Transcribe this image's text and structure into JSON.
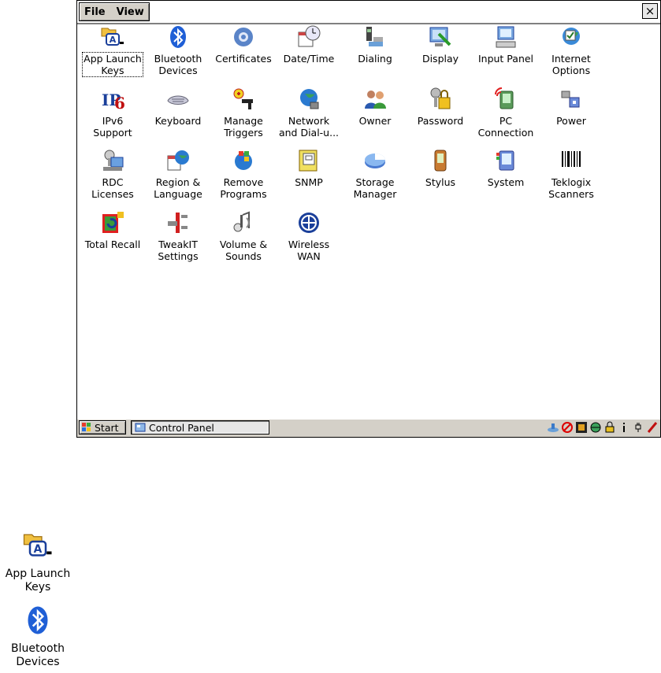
{
  "menu": {
    "file": "File",
    "view": "View"
  },
  "window": {
    "close": "×"
  },
  "icons": [
    {
      "name": "app-launch-keys",
      "icon": "app-launch-keys-icon",
      "l1": "App Launch",
      "l2": "Keys"
    },
    {
      "name": "bluetooth-devices",
      "icon": "bluetooth-icon",
      "l1": "Bluetooth",
      "l2": "Devices"
    },
    {
      "name": "certificates",
      "icon": "certificates-icon",
      "l1": "Certificates",
      "l2": ""
    },
    {
      "name": "date-time",
      "icon": "date-time-icon",
      "l1": "Date/Time",
      "l2": ""
    },
    {
      "name": "dialing",
      "icon": "dialing-icon",
      "l1": "Dialing",
      "l2": ""
    },
    {
      "name": "display",
      "icon": "display-icon",
      "l1": "Display",
      "l2": ""
    },
    {
      "name": "input-panel",
      "icon": "input-panel-icon",
      "l1": "Input Panel",
      "l2": ""
    },
    {
      "name": "internet-options",
      "icon": "internet-options-icon",
      "l1": "Internet",
      "l2": "Options"
    },
    {
      "name": "ipv6-support",
      "icon": "ipv6-icon",
      "l1": "IPv6",
      "l2": "Support"
    },
    {
      "name": "keyboard",
      "icon": "keyboard-icon",
      "l1": "Keyboard",
      "l2": ""
    },
    {
      "name": "manage-triggers",
      "icon": "manage-triggers-icon",
      "l1": "Manage",
      "l2": "Triggers"
    },
    {
      "name": "network-dialup",
      "icon": "network-icon",
      "l1": "Network",
      "l2": "and Dial-u..."
    },
    {
      "name": "owner",
      "icon": "owner-icon",
      "l1": "Owner",
      "l2": ""
    },
    {
      "name": "password",
      "icon": "password-icon",
      "l1": "Password",
      "l2": ""
    },
    {
      "name": "pc-connection",
      "icon": "pc-connection-icon",
      "l1": "PC",
      "l2": "Connection"
    },
    {
      "name": "power",
      "icon": "power-icon",
      "l1": "Power",
      "l2": ""
    },
    {
      "name": "rdc-licenses",
      "icon": "rdc-licenses-icon",
      "l1": "RDC",
      "l2": "Licenses"
    },
    {
      "name": "region-language",
      "icon": "region-language-icon",
      "l1": "Region &",
      "l2": "Language"
    },
    {
      "name": "remove-programs",
      "icon": "remove-programs-icon",
      "l1": "Remove",
      "l2": "Programs"
    },
    {
      "name": "snmp",
      "icon": "snmp-icon",
      "l1": "SNMP",
      "l2": ""
    },
    {
      "name": "storage-manager",
      "icon": "storage-manager-icon",
      "l1": "Storage",
      "l2": "Manager"
    },
    {
      "name": "stylus",
      "icon": "stylus-icon",
      "l1": "Stylus",
      "l2": ""
    },
    {
      "name": "system",
      "icon": "system-icon",
      "l1": "System",
      "l2": ""
    },
    {
      "name": "teklogix-scanners",
      "icon": "barcode-scanner-icon",
      "l1": "Teklogix",
      "l2": "Scanners"
    },
    {
      "name": "total-recall",
      "icon": "total-recall-icon",
      "l1": "Total Recall",
      "l2": ""
    },
    {
      "name": "tweakit-settings",
      "icon": "tweakit-icon",
      "l1": "TweakIT",
      "l2": "Settings"
    },
    {
      "name": "volume-sounds",
      "icon": "volume-icon",
      "l1": "Volume &",
      "l2": "Sounds"
    },
    {
      "name": "wireless-wan",
      "icon": "wireless-wan-icon",
      "l1": "Wireless",
      "l2": "WAN"
    }
  ],
  "taskbar": {
    "start": "Start",
    "task": "Control Panel"
  },
  "zoom": [
    {
      "name": "zoom-app-launch-keys",
      "icon": "app-launch-keys-icon",
      "l1": "App Launch",
      "l2": "Keys"
    },
    {
      "name": "zoom-bluetooth-devices",
      "icon": "bluetooth-icon",
      "l1": "Bluetooth",
      "l2": "Devices"
    }
  ],
  "colors": {
    "bluetooth": "#1f5fd6",
    "taskbar": "#d4d0c8",
    "accent": "#1a3f9a"
  }
}
